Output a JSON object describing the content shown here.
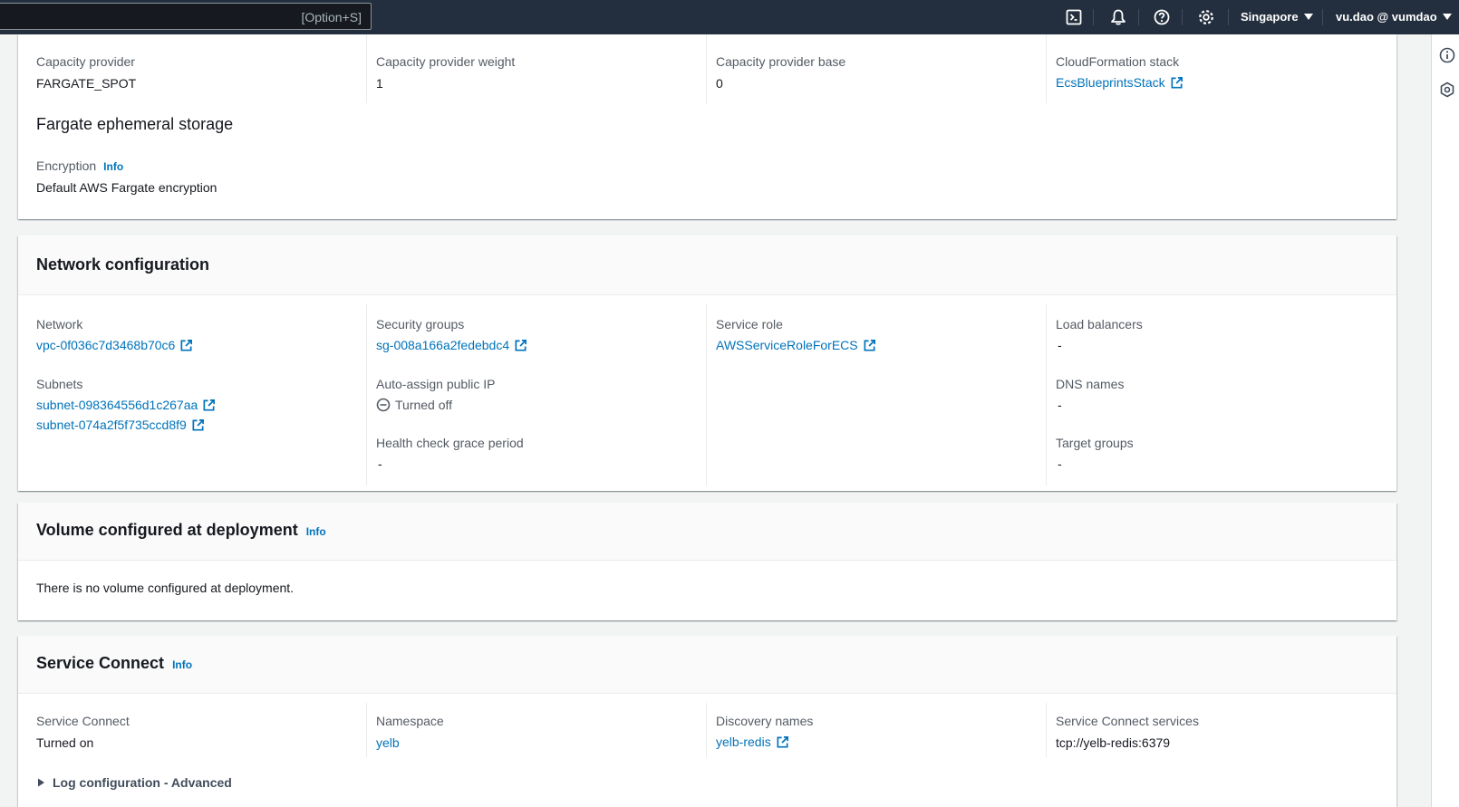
{
  "topnav": {
    "search_shortcut": "[Option+S]",
    "icons": [
      "cloudshell-icon",
      "bell-icon",
      "help-icon",
      "settings-icon"
    ],
    "region": "Singapore",
    "account": "vu.dao @ vumdao"
  },
  "capacity": {
    "provider_label": "Capacity provider",
    "provider_value": "FARGATE_SPOT",
    "weight_label": "Capacity provider weight",
    "weight_value": "1",
    "base_label": "Capacity provider base",
    "base_value": "0",
    "stack_label": "CloudFormation stack",
    "stack_value": "EcsBlueprintsStack"
  },
  "storage": {
    "heading": "Fargate ephemeral storage",
    "encryption_label": "Encryption",
    "info": "Info",
    "encryption_value": "Default AWS Fargate encryption"
  },
  "network": {
    "title": "Network configuration",
    "network_label": "Network",
    "network_value": "vpc-0f036c7d3468b70c6",
    "subnets_label": "Subnets",
    "subnets": [
      "subnet-098364556d1c267aa",
      "subnet-074a2f5f735ccd8f9"
    ],
    "sg_label": "Security groups",
    "sg_value": "sg-008a166a2fedebdc4",
    "public_ip_label": "Auto-assign public IP",
    "public_ip_value": "Turned off",
    "grace_label": "Health check grace period",
    "grace_value": "-",
    "role_label": "Service role",
    "role_value": "AWSServiceRoleForECS",
    "lb_label": "Load balancers",
    "lb_value": "-",
    "dns_label": "DNS names",
    "dns_value": "-",
    "tg_label": "Target groups",
    "tg_value": "-"
  },
  "volume": {
    "title": "Volume configured at deployment",
    "info": "Info",
    "message": "There is no volume configured at deployment."
  },
  "service_connect": {
    "title": "Service Connect",
    "info": "Info",
    "sc_label": "Service Connect",
    "sc_value": "Turned on",
    "ns_label": "Namespace",
    "ns_value": "yelb",
    "dn_label": "Discovery names",
    "dn_value": "yelb-redis",
    "svc_label": "Service Connect services",
    "svc_value": "tcp://yelb-redis:6379",
    "log_toggle": "Log configuration - Advanced"
  }
}
